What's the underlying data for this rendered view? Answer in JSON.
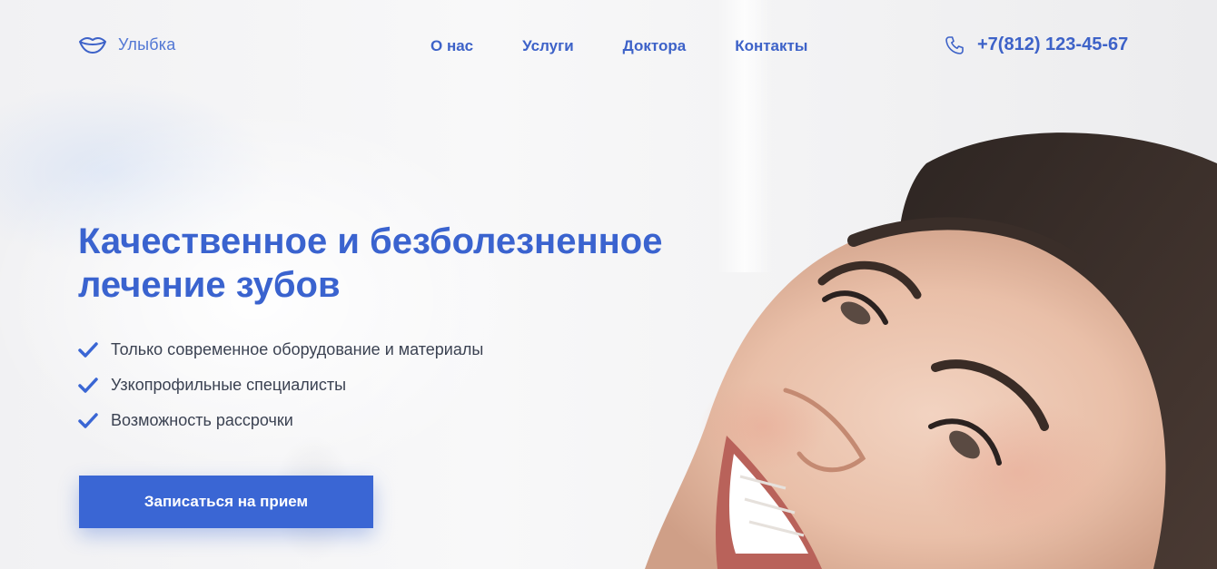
{
  "header": {
    "logo_text": "Улыбка",
    "nav": [
      {
        "label": "О нас"
      },
      {
        "label": "Услуги"
      },
      {
        "label": "Доктора"
      },
      {
        "label": "Контакты"
      }
    ],
    "phone": "+7(812) 123-45-67"
  },
  "hero": {
    "headline_line1": "Качественное и безболезненное",
    "headline_line2": "лечение зубов",
    "features": [
      {
        "text": "Только современное оборудование и материалы"
      },
      {
        "text": "Узкопрофильные специалисты"
      },
      {
        "text": "Возможность рассрочки"
      }
    ],
    "cta_label": "Записаться на прием"
  },
  "icons": {
    "logo": "smile-lips-icon",
    "phone": "phone-icon",
    "check": "checkmark-icon"
  },
  "colors": {
    "accent": "#3a66d4",
    "text": "#3b4252",
    "background": "#f6f6f7"
  }
}
